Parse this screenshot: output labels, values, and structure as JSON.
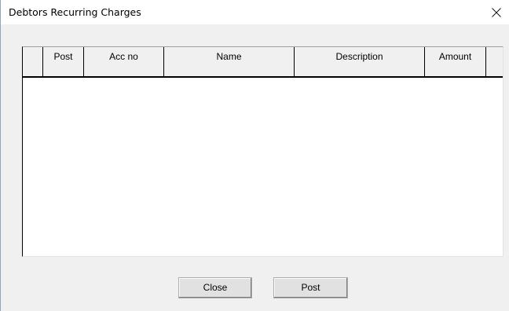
{
  "window": {
    "title": "Debtors Recurring Charges",
    "close_icon": "close-x-icon"
  },
  "grid": {
    "columns": [
      {
        "key": "selector",
        "label": ""
      },
      {
        "key": "post",
        "label": "Post"
      },
      {
        "key": "acc_no",
        "label": "Acc no"
      },
      {
        "key": "name",
        "label": "Name"
      },
      {
        "key": "description",
        "label": "Description"
      },
      {
        "key": "amount",
        "label": "Amount"
      },
      {
        "key": "extra",
        "label": ""
      }
    ],
    "rows": []
  },
  "buttons": {
    "close_label": "Close",
    "post_label": "Post"
  },
  "colors": {
    "client_bg": "#f0f0f0",
    "grid_bg": "#ffffff",
    "window_border": "#8fa6bf"
  }
}
